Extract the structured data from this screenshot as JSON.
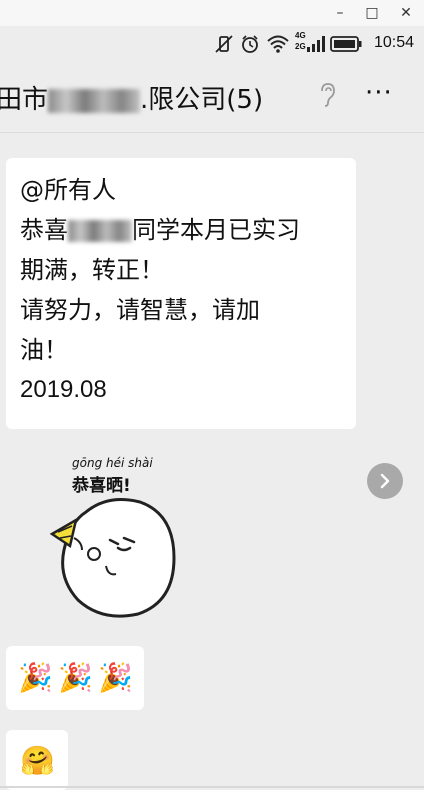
{
  "window": {
    "minimize_label": "–",
    "maximize_label": "□",
    "close_label": "✕"
  },
  "status_bar": {
    "time": "10:54",
    "network_top": "4G",
    "network_bottom": "2G",
    "icons": [
      "mute-vibrate-icon",
      "alarm-icon",
      "wifi-icon",
      "signal-icon",
      "battery-icon"
    ]
  },
  "header": {
    "title_prefix": "田市",
    "title_suffix": ".限公司(5)",
    "icons": [
      "ear-icon",
      "more-icon"
    ],
    "more_label": "···"
  },
  "messages": [
    {
      "type": "text",
      "lines": [
        "@所有人",
        "恭喜",
        "同学本月已实习",
        "期满，转正！",
        "请努力，请智慧，请加",
        "油！",
        "2019.08"
      ]
    },
    {
      "type": "sticker",
      "pinyin": "gōng héi shài",
      "text": "恭喜晒!"
    },
    {
      "type": "emoji",
      "emoji": [
        "🎉",
        "🎉",
        "🎉"
      ]
    },
    {
      "type": "emoji",
      "emoji": [
        "🤗"
      ]
    }
  ],
  "colors": {
    "background": "#ededed",
    "bubble": "#ffffff",
    "arrow_button": "#a9a9a9"
  }
}
